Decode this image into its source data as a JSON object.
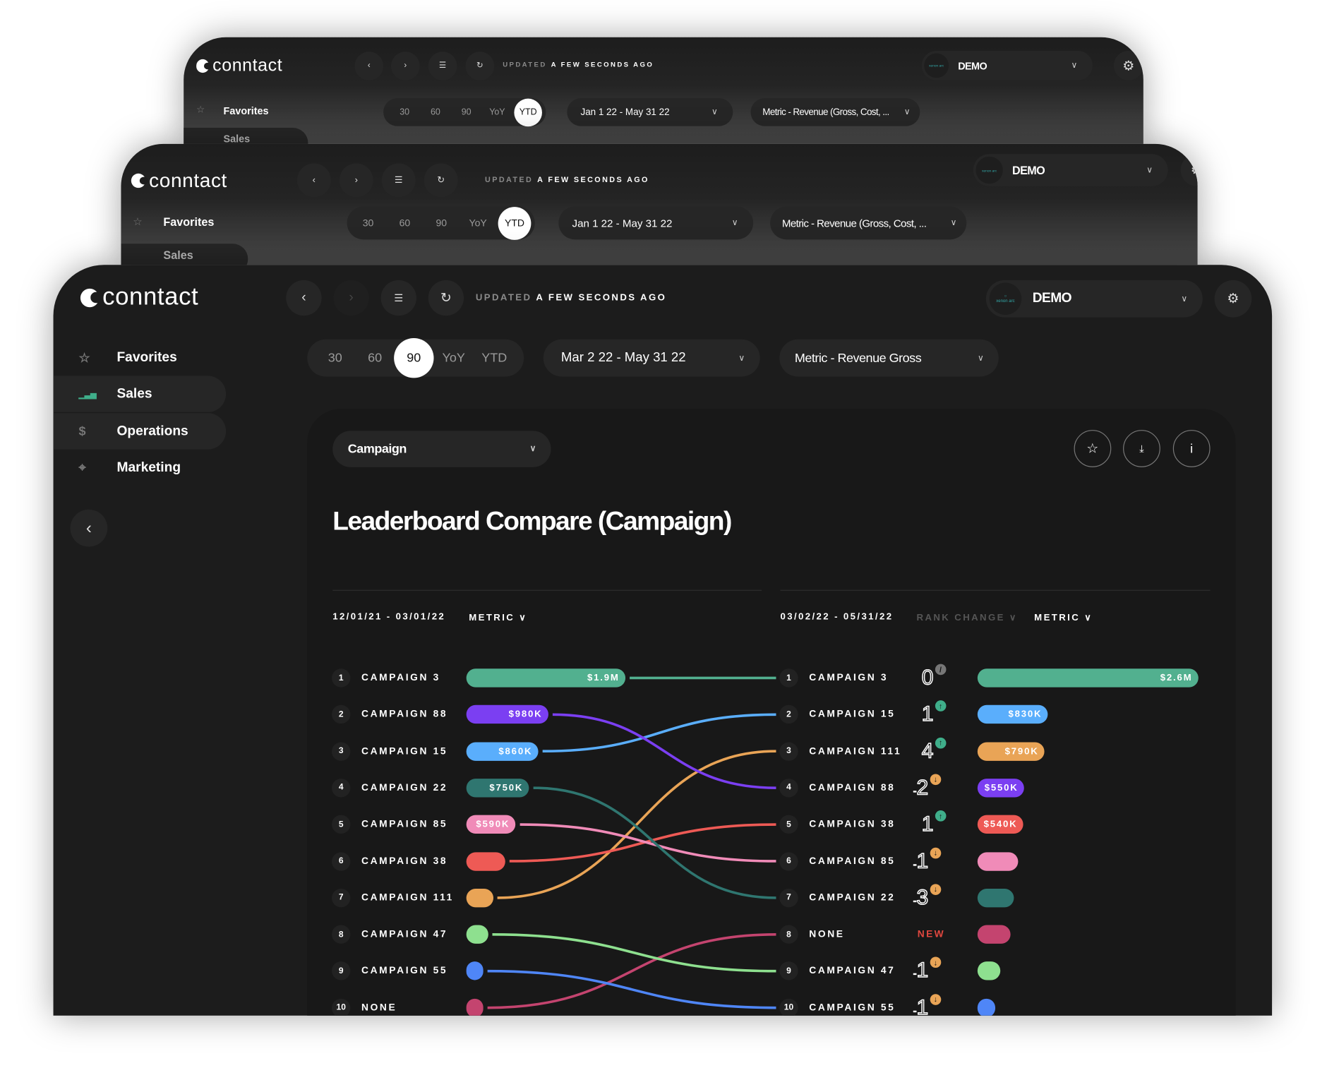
{
  "brand": "conntact",
  "back_windows": [
    {
      "updated_prefix": "UPDATED",
      "updated_text": "A FEW SECONDS AGO",
      "account": "DEMO",
      "avatar_text": "xenon arc",
      "periods": [
        "30",
        "60",
        "90",
        "YoY",
        "YTD"
      ],
      "active_period": "YTD",
      "date_range": "Jan 1 22 - May 31 22",
      "metric": "Metric - Revenue (Gross, Cost, ...",
      "sidebar": [
        "Favorites",
        "Sales"
      ]
    },
    {
      "updated_prefix": "UPDATED",
      "updated_text": "A FEW SECONDS AGO",
      "account": "DEMO",
      "avatar_text": "xenon arc",
      "periods": [
        "30",
        "60",
        "90",
        "YoY",
        "YTD"
      ],
      "active_period": "YTD",
      "date_range": "Jan 1 22 - May 31 22",
      "metric": "Metric - Revenue (Gross, Cost, ...",
      "sidebar": [
        "Favorites",
        "Sales"
      ]
    }
  ],
  "main": {
    "updated_prefix": "UPDATED",
    "updated_text": "A FEW SECONDS AGO",
    "account": "DEMO",
    "avatar_text": "xenon arc",
    "sidebar": [
      {
        "label": "Favorites",
        "icon": "star-icon"
      },
      {
        "label": "Sales",
        "icon": "bar-chart-icon",
        "active": true
      },
      {
        "label": "Operations",
        "icon": "dollar-icon"
      },
      {
        "label": "Marketing",
        "icon": "crosshair-icon"
      }
    ],
    "periods": [
      "30",
      "60",
      "90",
      "YoY",
      "YTD"
    ],
    "active_period": "90",
    "date_range": "Mar 2 22 - May 31 22",
    "metric": "Metric - Revenue Gross",
    "dropdown": "Campaign",
    "title": "Leaderboard Compare (Campaign)",
    "left_header": {
      "date": "12/01/21 - 03/01/22",
      "metric": "METRIC"
    },
    "right_header": {
      "date": "03/02/22 - 05/31/22",
      "rank_change": "RANK CHANGE",
      "metric": "METRIC"
    }
  },
  "chart_data": {
    "type": "bar",
    "colors": {
      "Campaign 3": "#52b08f",
      "Campaign 88": "#7b3ff2",
      "Campaign 15": "#5aaefc",
      "Campaign 22": "#2f7670",
      "Campaign 85": "#f08bb8",
      "Campaign 38": "#ee5a55",
      "Campaign 111": "#e9a456",
      "Campaign 47": "#8ee08f",
      "Campaign 55": "#4f86f7",
      "None": "#c4446f"
    },
    "left": [
      {
        "rank": 1,
        "name": "CAMPAIGN 3",
        "key": "Campaign 3",
        "value": 1900000,
        "label": "$1.9M"
      },
      {
        "rank": 2,
        "name": "CAMPAIGN 88",
        "key": "Campaign 88",
        "value": 980000,
        "label": "$980K"
      },
      {
        "rank": 3,
        "name": "CAMPAIGN 15",
        "key": "Campaign 15",
        "value": 860000,
        "label": "$860K"
      },
      {
        "rank": 4,
        "name": "CAMPAIGN 22",
        "key": "Campaign 22",
        "value": 750000,
        "label": "$750K"
      },
      {
        "rank": 5,
        "name": "CAMPAIGN 85",
        "key": "Campaign 85",
        "value": 590000,
        "label": "$590K"
      },
      {
        "rank": 6,
        "name": "CAMPAIGN 38",
        "key": "Campaign 38",
        "value": 465000
      },
      {
        "rank": 7,
        "name": "CAMPAIGN 111",
        "key": "Campaign 111",
        "value": 320000
      },
      {
        "rank": 8,
        "name": "CAMPAIGN 47",
        "key": "Campaign 47",
        "value": 260000
      },
      {
        "rank": 9,
        "name": "CAMPAIGN 55",
        "key": "Campaign 55",
        "value": 200000
      },
      {
        "rank": 10,
        "name": "NONE",
        "key": "None",
        "value": 140000
      }
    ],
    "right": [
      {
        "rank": 1,
        "name": "CAMPAIGN 3",
        "key": "Campaign 3",
        "value": 2600000,
        "label": "$2.6M",
        "rank_change": "0",
        "direction": "same"
      },
      {
        "rank": 2,
        "name": "CAMPAIGN 15",
        "key": "Campaign 15",
        "value": 830000,
        "label": "$830K",
        "rank_change": "1",
        "direction": "up"
      },
      {
        "rank": 3,
        "name": "CAMPAIGN 111",
        "key": "Campaign 111",
        "value": 790000,
        "label": "$790K",
        "rank_change": "4",
        "direction": "up"
      },
      {
        "rank": 4,
        "name": "CAMPAIGN 88",
        "key": "Campaign 88",
        "value": 550000,
        "label": "$550K",
        "rank_change": "-2",
        "direction": "down"
      },
      {
        "rank": 5,
        "name": "CAMPAIGN 38",
        "key": "Campaign 38",
        "value": 540000,
        "label": "$540K",
        "rank_change": "1",
        "direction": "up"
      },
      {
        "rank": 6,
        "name": "CAMPAIGN 85",
        "key": "Campaign 85",
        "value": 480000,
        "rank_change": "-1",
        "direction": "down"
      },
      {
        "rank": 7,
        "name": "CAMPAIGN 22",
        "key": "Campaign 22",
        "value": 430000,
        "rank_change": "-3",
        "direction": "down"
      },
      {
        "rank": 8,
        "name": "NONE",
        "key": "None",
        "value": 390000,
        "rank_change": "NEW",
        "direction": "new"
      },
      {
        "rank": 9,
        "name": "CAMPAIGN 47",
        "key": "Campaign 47",
        "value": 270000,
        "rank_change": "-1",
        "direction": "down"
      },
      {
        "rank": 10,
        "name": "CAMPAIGN 55",
        "key": "Campaign 55",
        "value": 210000,
        "rank_change": "-1",
        "direction": "down"
      }
    ]
  }
}
